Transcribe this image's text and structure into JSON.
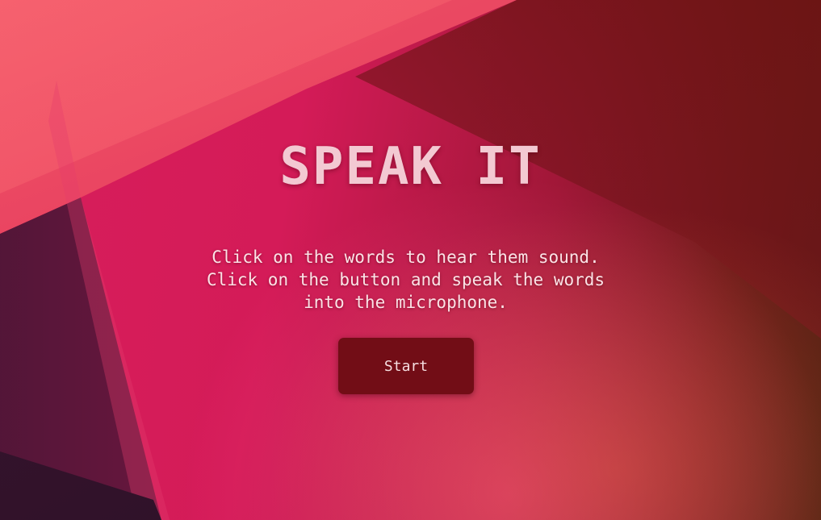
{
  "page": {
    "title": "SPEAK IT",
    "description": "Click on the words to hear them sound. Click on the button and speak the words into the microphone.",
    "start_button_label": "Start"
  },
  "colors": {
    "title_text": "#f3c9d2",
    "button_bg": "#720d16",
    "accent_pink": "#d81e5b",
    "dark_red": "#6e1a1a"
  }
}
